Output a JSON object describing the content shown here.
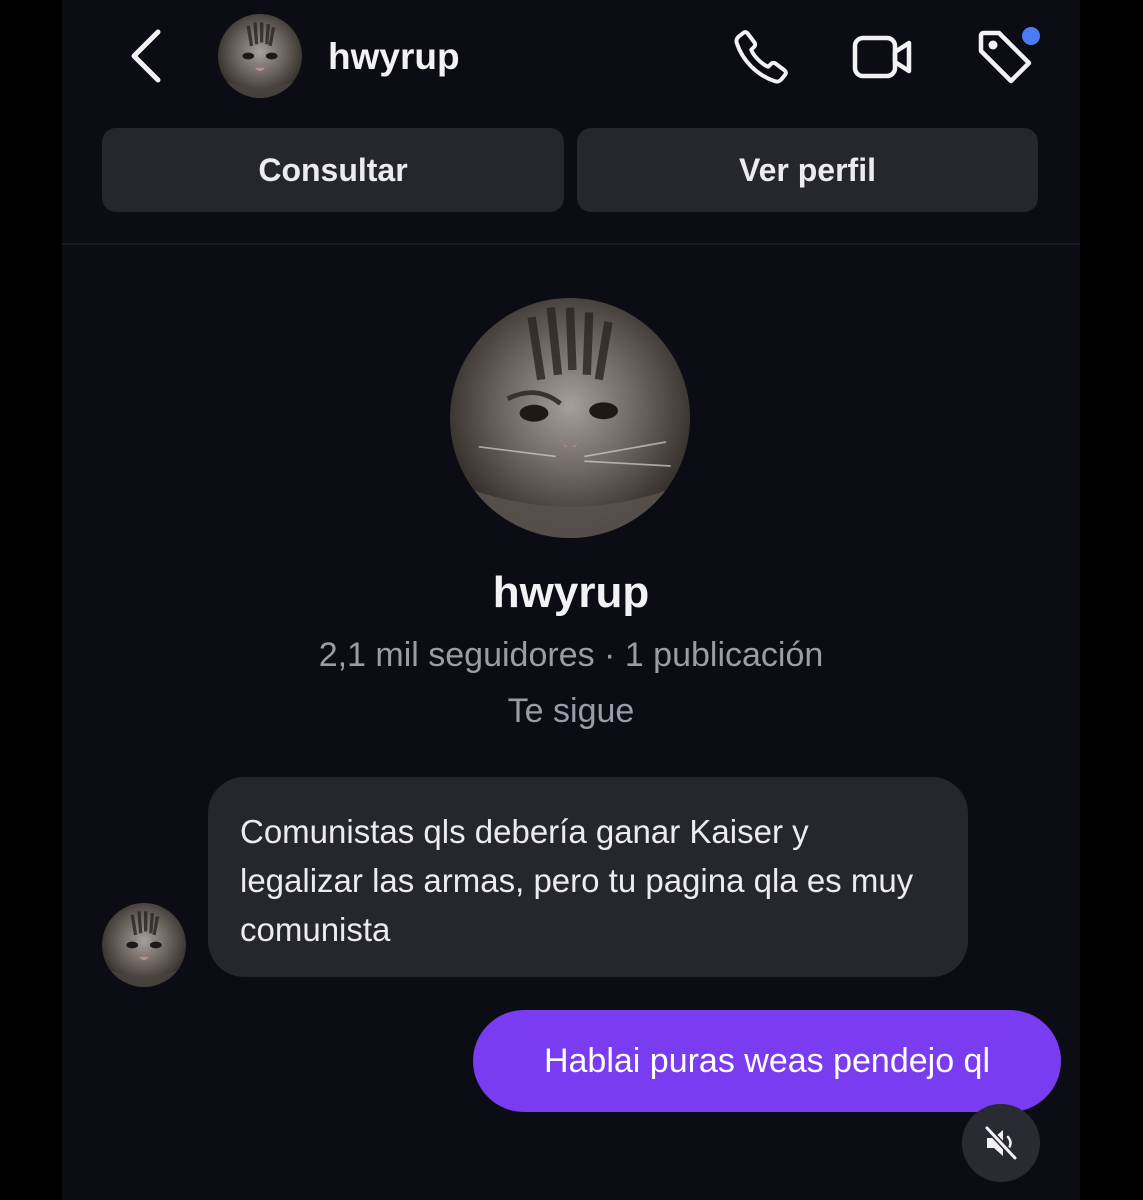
{
  "header": {
    "username": "hwyrup",
    "icons": [
      "back-chevron-icon",
      "phone-icon",
      "video-camera-icon",
      "tag-icon"
    ],
    "notification_dot_color": "#4b7bf5"
  },
  "actions": {
    "consult_label": "Consultar",
    "profile_label": "Ver perfil"
  },
  "profile": {
    "name": "hwyrup",
    "stats": "2,1 mil seguidores · 1 publicación",
    "follows_you": "Te sigue"
  },
  "messages": [
    {
      "sender": "hwyrup",
      "direction": "incoming",
      "text": "Comunistas qls debería ganar Kaiser y legalizar las armas, pero tu pagina qla es muy comunista"
    },
    {
      "sender": "me",
      "direction": "outgoing",
      "text": "Hablai puras weas pendejo ql"
    }
  ],
  "colors": {
    "background": "#0c0c14",
    "bubble_incoming": "#26262e",
    "bubble_outgoing": "#7a3cf0"
  }
}
